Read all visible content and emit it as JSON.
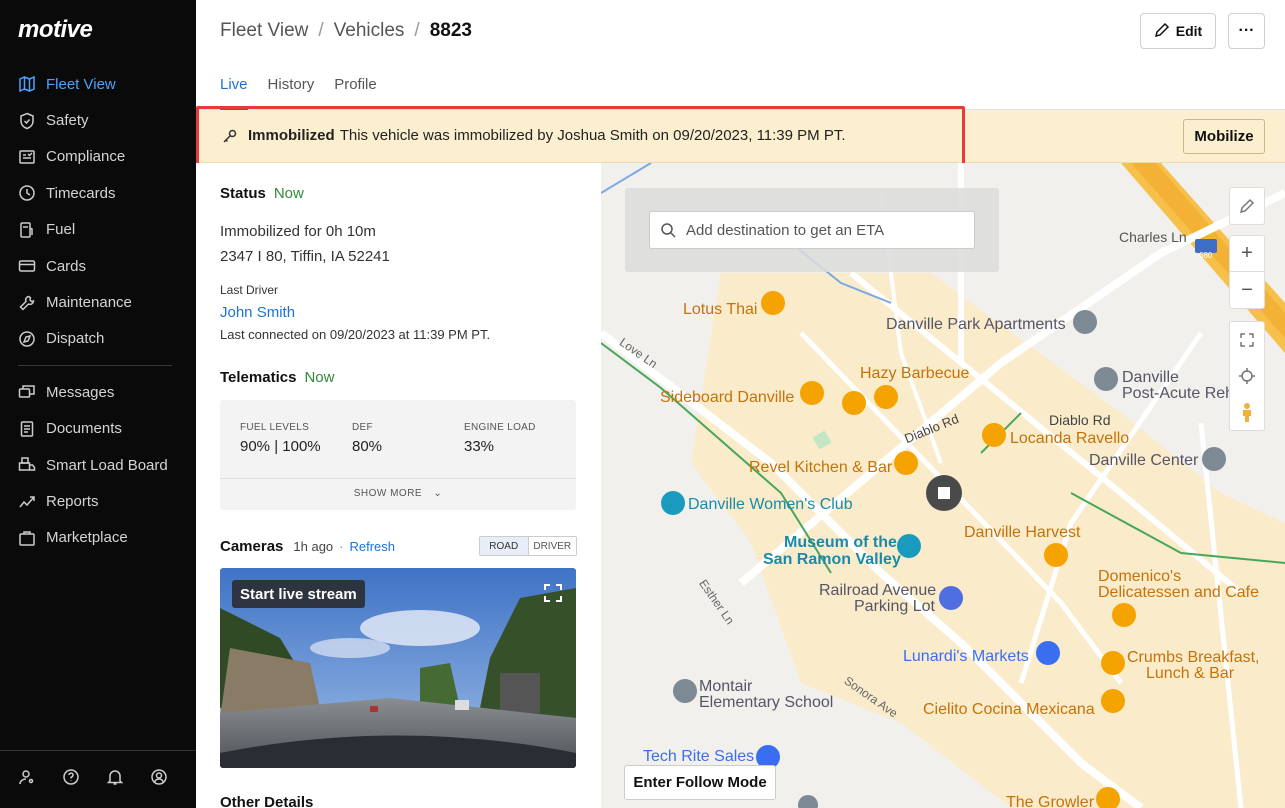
{
  "sidebar": {
    "logo": "motive",
    "items": [
      {
        "label": "Fleet View",
        "icon": "map-icon",
        "active": true
      },
      {
        "label": "Safety",
        "icon": "shield-icon"
      },
      {
        "label": "Compliance",
        "icon": "compliance-icon"
      },
      {
        "label": "Timecards",
        "icon": "clock-icon"
      },
      {
        "label": "Fuel",
        "icon": "fuel-icon"
      },
      {
        "label": "Cards",
        "icon": "card-icon"
      },
      {
        "label": "Maintenance",
        "icon": "wrench-icon"
      },
      {
        "label": "Dispatch",
        "icon": "dispatch-icon"
      },
      {
        "label": "Messages",
        "icon": "messages-icon"
      },
      {
        "label": "Documents",
        "icon": "document-icon"
      },
      {
        "label": "Smart Load Board",
        "icon": "load-board-icon"
      },
      {
        "label": "Reports",
        "icon": "reports-icon"
      },
      {
        "label": "Marketplace",
        "icon": "marketplace-icon"
      }
    ],
    "bottom_icons": [
      "user-settings-icon",
      "help-icon",
      "bell-icon",
      "profile-icon"
    ]
  },
  "header": {
    "breadcrumb": [
      "Fleet View",
      "Vehicles",
      "8823"
    ],
    "edit_label": "Edit",
    "more_label": "···",
    "tabs": [
      "Live",
      "History",
      "Profile"
    ],
    "active_tab": "Live"
  },
  "banner": {
    "title": "Immobilized",
    "message": "This vehicle was immobilized by Joshua Smith on 09/20/2023, 11:39 PM PT.",
    "action": "Mobilize",
    "bg_color": "#fbefcf"
  },
  "status": {
    "title": "Status",
    "now": "Now",
    "duration": "Immobilized for 0h 10m",
    "address": "2347 I 80, Tiffin, IA 52241",
    "last_driver_label": "Last Driver",
    "last_driver": "John Smith",
    "last_connected": "Last connected on 09/20/2023 at 11:39 PM PT."
  },
  "telematics": {
    "title": "Telematics",
    "now": "Now",
    "metrics": [
      {
        "label": "FUEL LEVELS",
        "value": "90% | 100%"
      },
      {
        "label": "DEF",
        "value": "80%"
      },
      {
        "label": "ENGINE LOAD",
        "value": "33%"
      }
    ],
    "show_more": "SHOW MORE"
  },
  "cameras": {
    "title": "Cameras",
    "ago": "1h ago",
    "refresh": "Refresh",
    "toggle": [
      "ROAD",
      "DRIVER"
    ],
    "live_stream": "Start live stream"
  },
  "other_details": "Other Details",
  "map": {
    "search_placeholder": "Add destination to get an ETA",
    "follow_mode": "Enter Follow Mode",
    "labels": {
      "charles": "Charles Ln",
      "lotus": "Lotus Thai",
      "danville_park": "Danville Park Apartments",
      "love_ln": "Love Ln",
      "hazy": "Hazy Barbecue",
      "danville_post_1": "Danville",
      "danville_post_2": "Post-Acute Reh",
      "sideboard": "Sideboard Danville",
      "diablo_rd": "Diablo Rd",
      "diablo_rd2": "Diablo Rd",
      "locanda": "Locanda Ravello",
      "danville_center": "Danville Center",
      "revel": "Revel Kitchen & Bar",
      "womens_club": "Danville Women's Club",
      "danville_harvest": "Danville Harvest",
      "museum_1": "Museum of the",
      "museum_2": "San Ramon Valley",
      "esther": "Esther Ln",
      "railroad_1": "Railroad Avenue",
      "railroad_2": "Parking Lot",
      "domenicos_1": "Domenico's",
      "domenicos_2": "Delicatessen and Cafe",
      "lunardis": "Lunardi's Markets",
      "crumbs_1": "Crumbs Breakfast,",
      "crumbs_2": "Lunch & Bar",
      "montair_1": "Montair",
      "montair_2": "Elementary School",
      "sonora": "Sonora Ave",
      "cielito": "Cielito Cocina Mexicana",
      "techrite": "Tech Rite Sales",
      "growler": "The Growler",
      "highway": "680"
    }
  }
}
